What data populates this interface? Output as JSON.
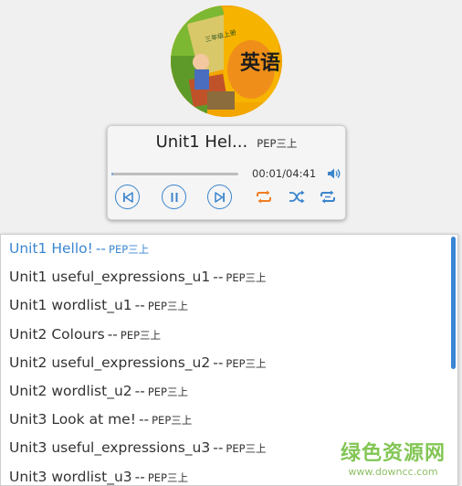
{
  "player": {
    "title": "Unit1 Hel...",
    "subtitle": "PEP三上",
    "current_time": "00:01",
    "total_time": "04:41",
    "time_display": "00:01/04:41",
    "progress": 0.004,
    "controls": {
      "prev": "prev-icon",
      "pause": "pause-icon",
      "next": "next-icon",
      "repeat": "repeat-icon",
      "shuffle": "shuffle-icon",
      "repeat_one": "loop-icon",
      "volume": "volume-icon"
    },
    "accent_color": "#3a85cc",
    "active_control_color": "#f07d22"
  },
  "playlist": {
    "separator": "--",
    "items": [
      {
        "name": "Unit1 Hello!",
        "sub": "PEP三上",
        "active": true
      },
      {
        "name": "Unit1 useful_expressions_u1",
        "sub": "PEP三上",
        "active": false
      },
      {
        "name": "Unit1 wordlist_u1",
        "sub": "PEP三上",
        "active": false
      },
      {
        "name": "Unit2 Colours",
        "sub": "PEP三上",
        "active": false
      },
      {
        "name": "Unit2 useful_expressions_u2",
        "sub": "PEP三上",
        "active": false
      },
      {
        "name": "Unit2 wordlist_u2",
        "sub": "PEP三上",
        "active": false
      },
      {
        "name": "Unit3 Look at me!",
        "sub": "PEP三上",
        "active": false
      },
      {
        "name": "Unit3 useful_expressions_u3",
        "sub": "PEP三上",
        "active": false
      },
      {
        "name": "Unit3 wordlist_u3",
        "sub": "PEP三上",
        "active": false
      }
    ]
  },
  "cover": {
    "text": "英语",
    "grade_text": "三年级上册"
  },
  "watermark": {
    "main": "绿色资源网",
    "url": "www.downcc.com"
  }
}
